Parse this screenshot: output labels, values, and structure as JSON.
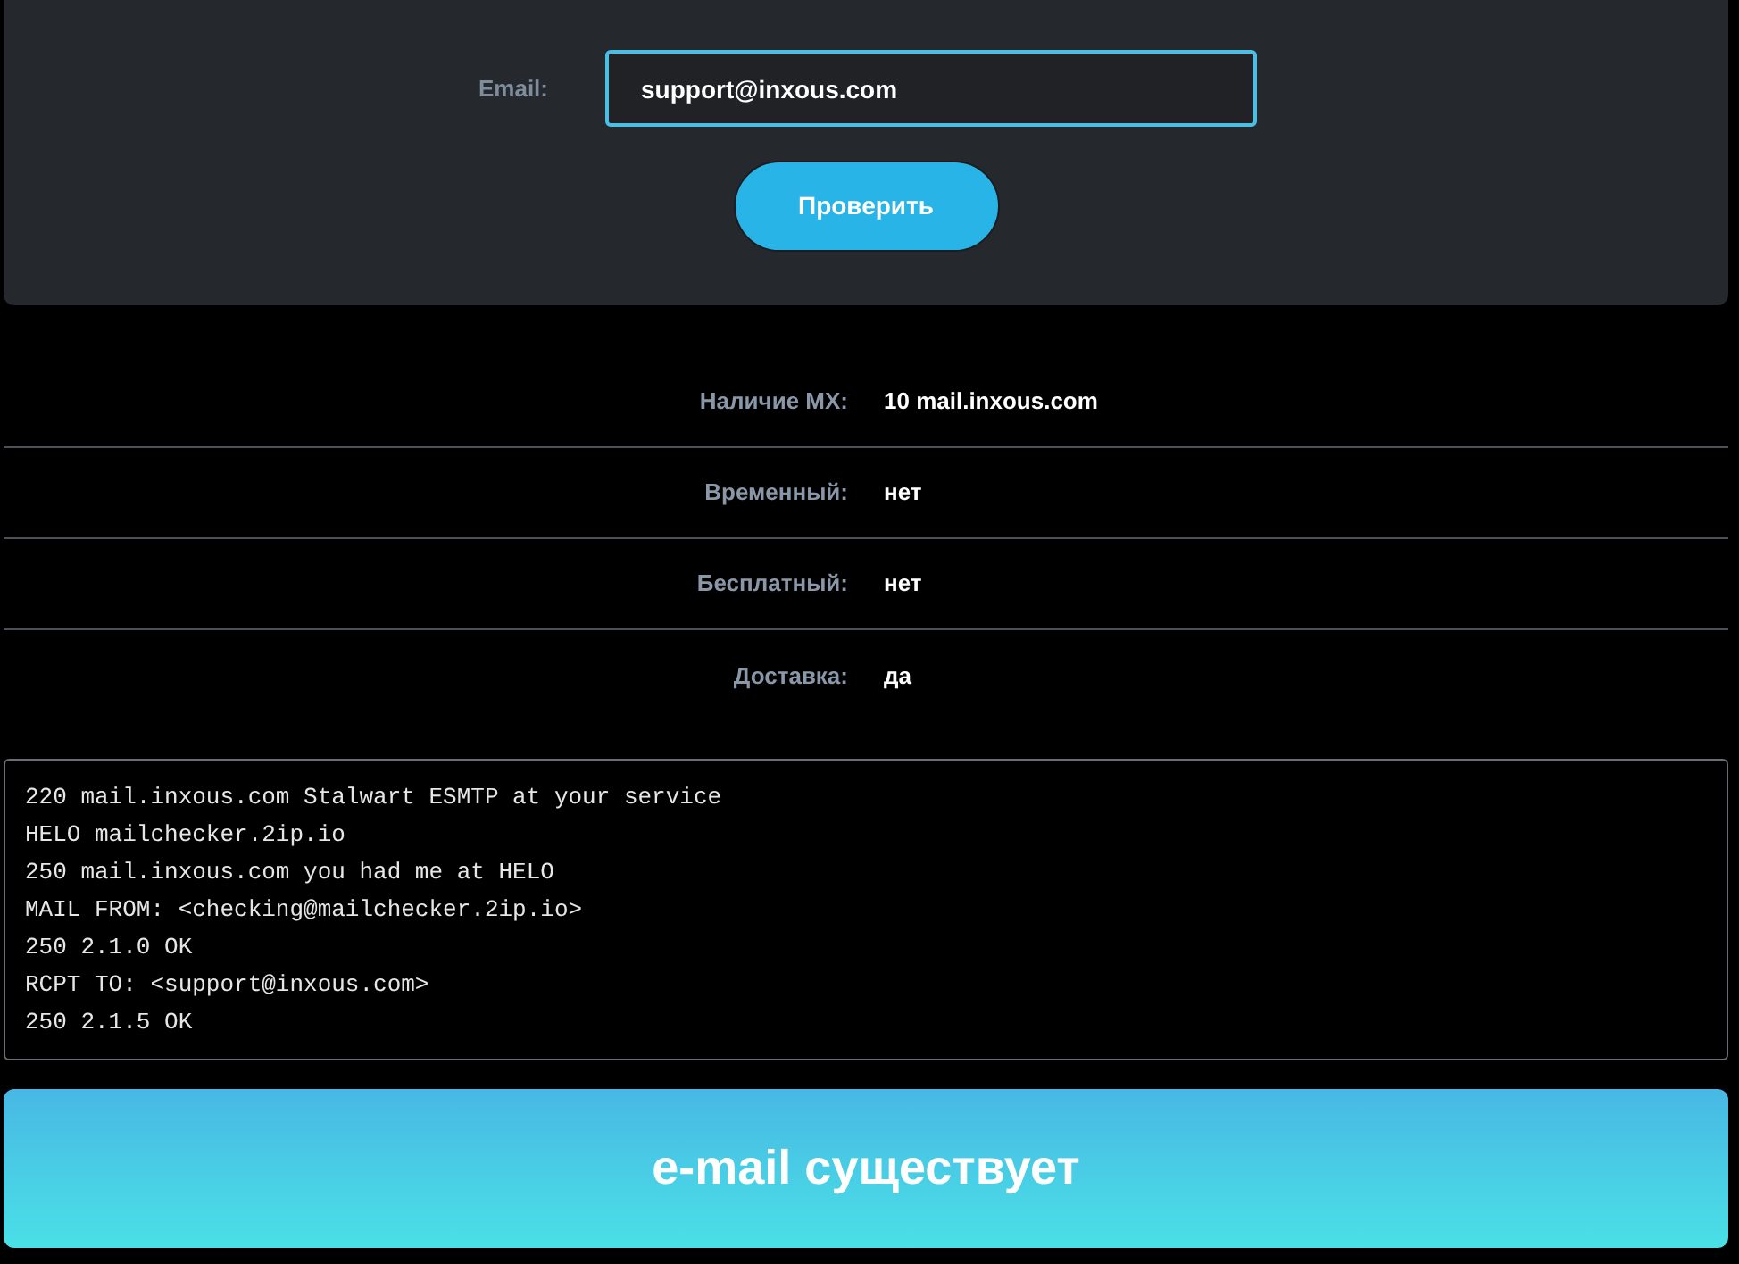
{
  "form": {
    "email_label": "Email:",
    "email_value": "support@inxous.com",
    "check_button": "Проверить"
  },
  "results": [
    {
      "label": "Наличие MX:",
      "value": "10 mail.inxous.com"
    },
    {
      "label": "Временный:",
      "value": "нет"
    },
    {
      "label": "Бесплатный:",
      "value": "нет"
    },
    {
      "label": "Доставка:",
      "value": "да"
    }
  ],
  "smtp_log": [
    "220 mail.inxous.com Stalwart ESMTP at your service",
    "HELO mailchecker.2ip.io",
    "250 mail.inxous.com you had me at HELO",
    "MAIL FROM: <checking@mailchecker.2ip.io>",
    "250 2.1.0 OK",
    "RCPT TO: <support@inxous.com>",
    "250 2.1.5 OK"
  ],
  "verdict": {
    "text": "e-mail существует"
  }
}
